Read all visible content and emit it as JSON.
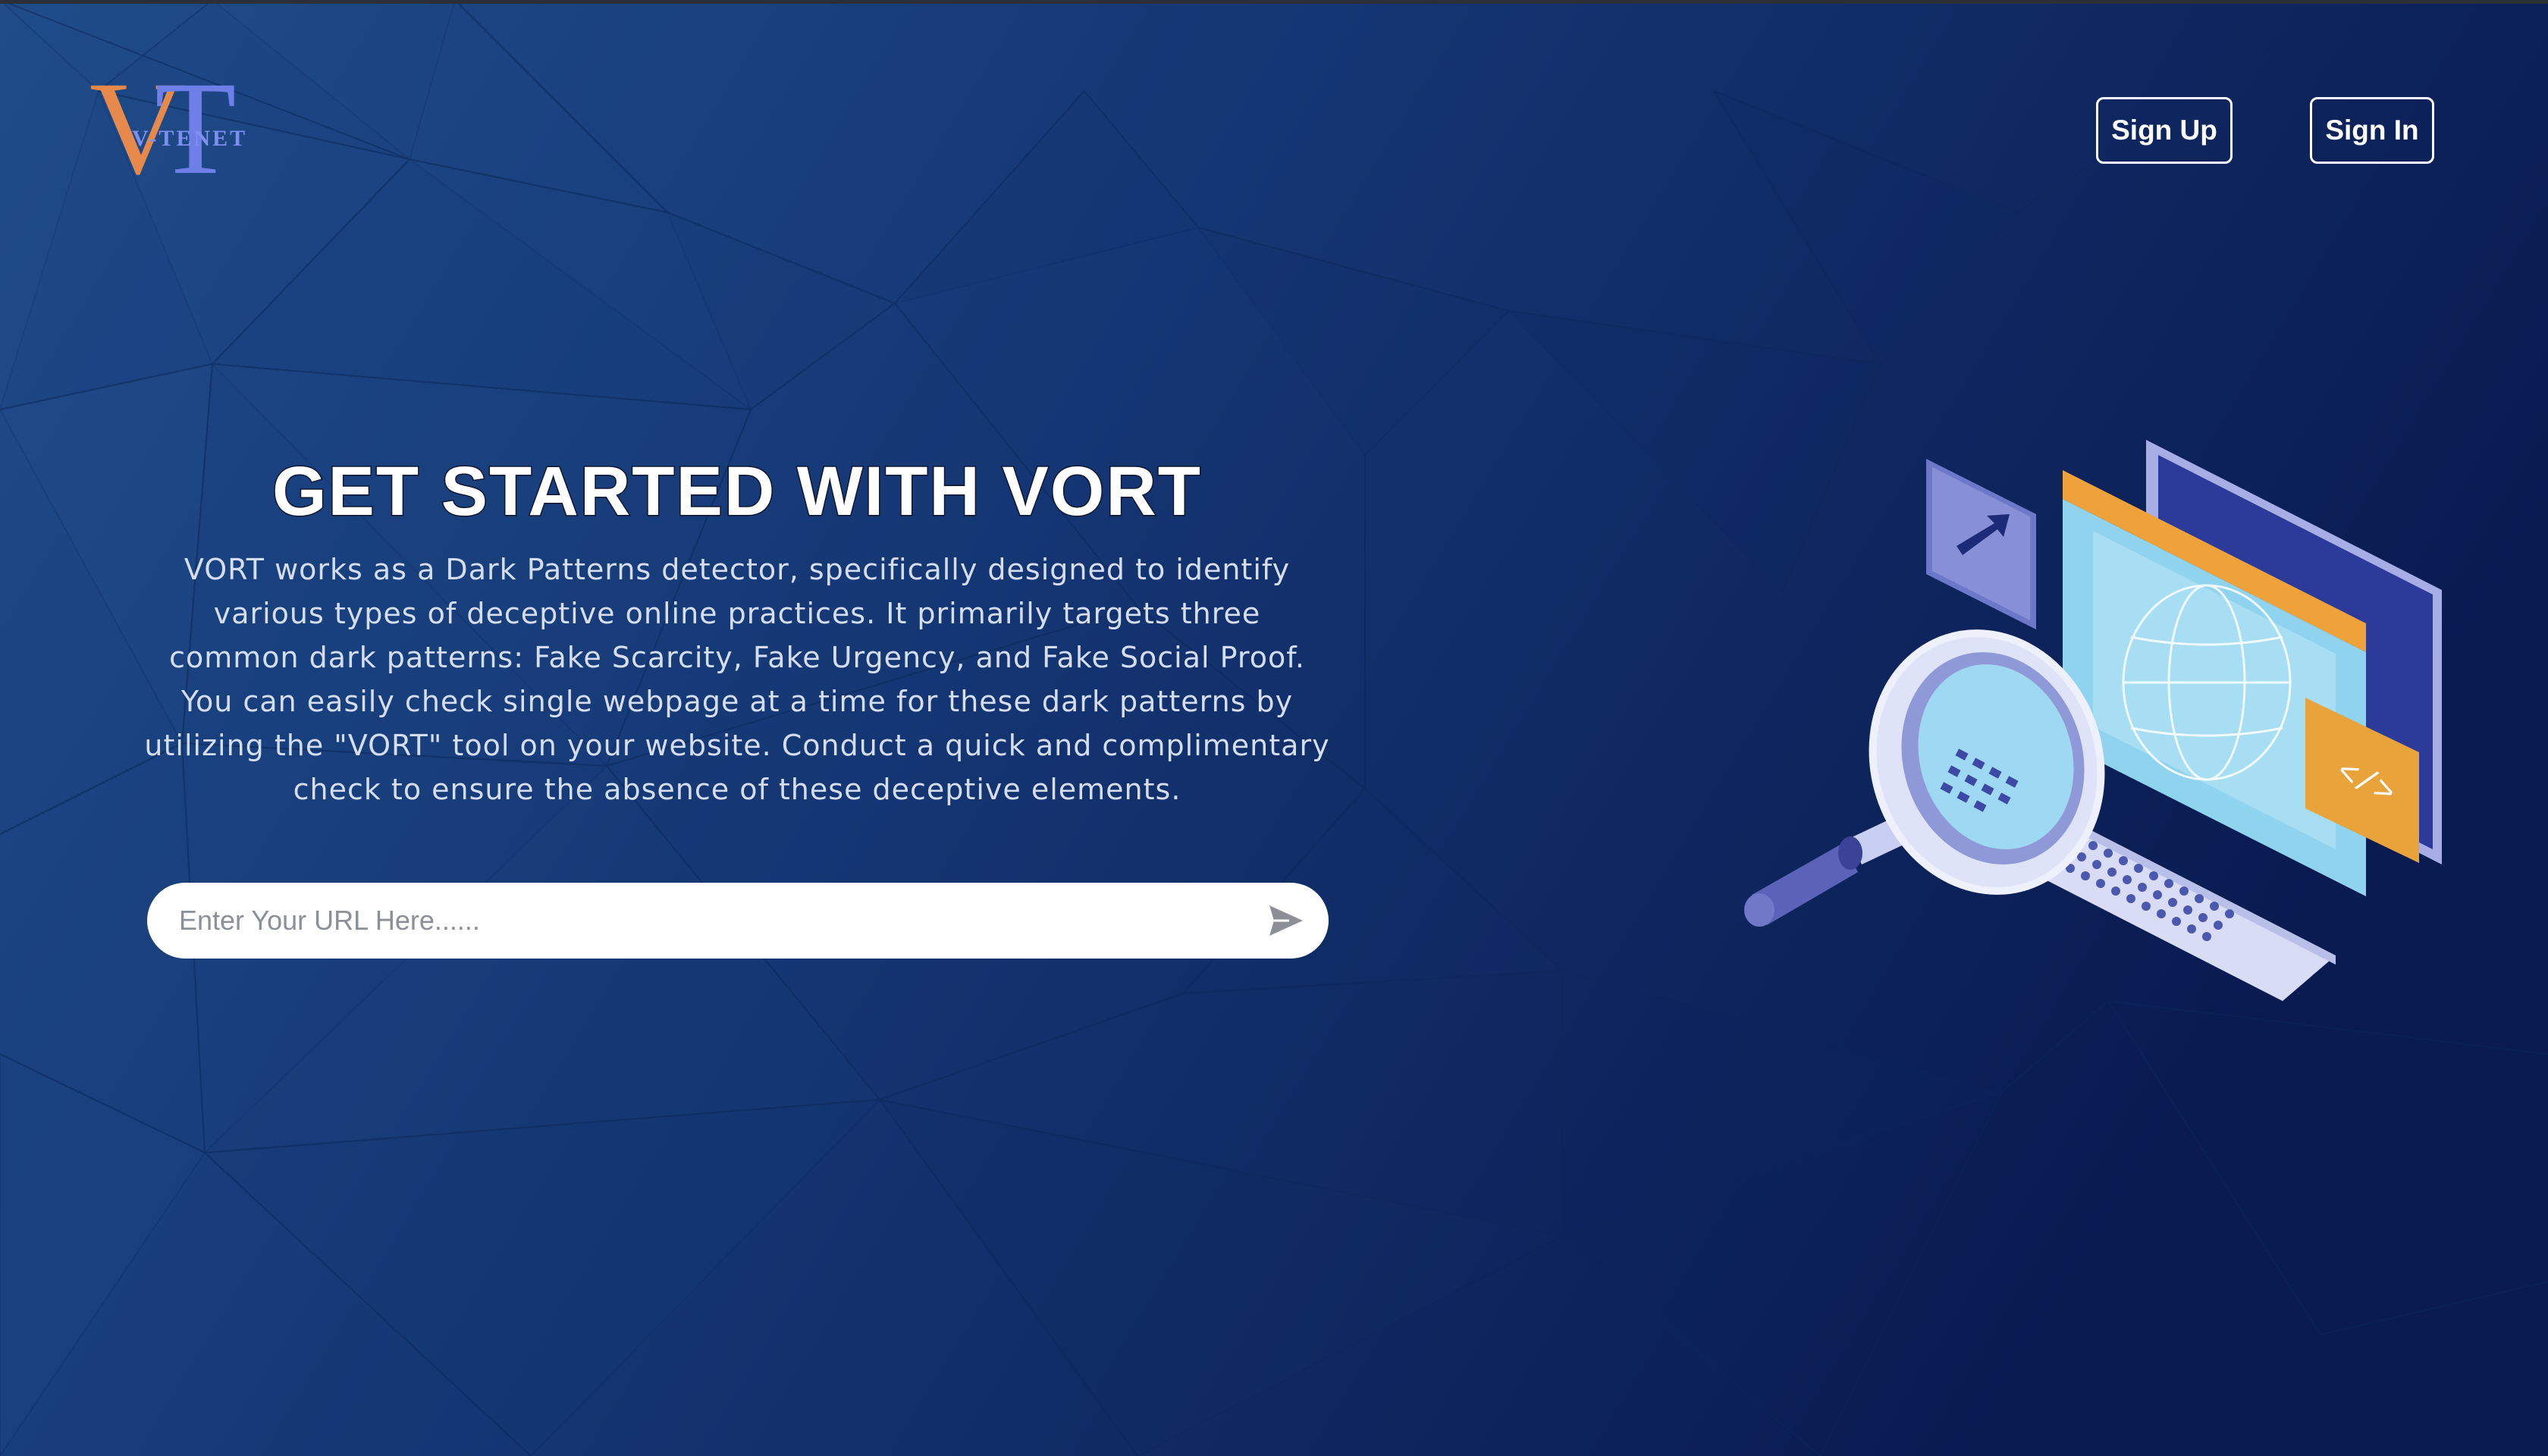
{
  "header": {
    "logo_text": "V-TENET",
    "logo_letters": [
      "V",
      "T"
    ],
    "signup_label": "Sign Up",
    "signin_label": "Sign In"
  },
  "hero": {
    "title": "GET STARTED WITH VORT",
    "description": "VORT works as a Dark Patterns detector, specifically designed to identify various types of deceptive online practices. It primarily targets three common dark patterns: Fake Scarcity, Fake Urgency, and Fake Social Proof. You can easily check single webpage at a time for these dark patterns by utilizing the \"VORT\" tool on your website. Conduct a quick and complimentary check to ensure the absence of these deceptive elements."
  },
  "search": {
    "placeholder": "Enter Your URL Here......",
    "value": ""
  },
  "icons": {
    "send": "send-icon",
    "illustration": "magnifier-laptop-illustration"
  },
  "colors": {
    "background_dark": "#0b1f52",
    "background_light": "#1f4785",
    "logo_orange": "#e6894b",
    "logo_blue": "#6f7fe8",
    "accent_orange": "#f0a23a"
  }
}
